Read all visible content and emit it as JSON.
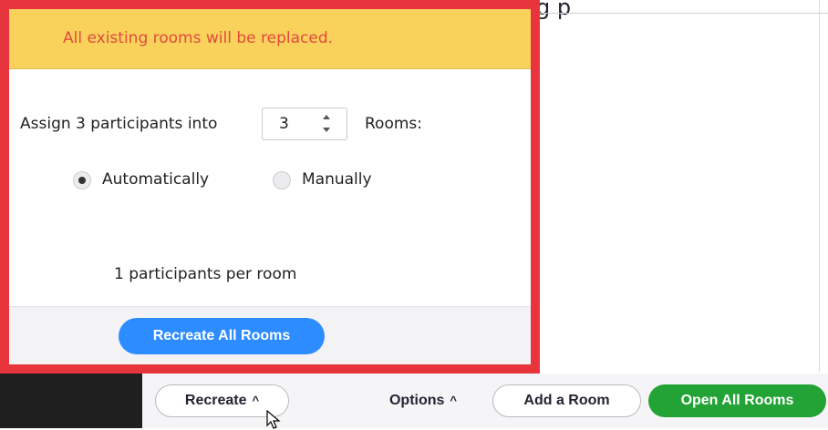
{
  "background": {
    "heading_fragment": "g          p"
  },
  "popover": {
    "warning": "All existing rooms will be replaced.",
    "assign_prefix": "Assign 3 participants into",
    "rooms_count": "3",
    "rooms_suffix": "Rooms:",
    "options": [
      {
        "label": "Automatically",
        "selected": true
      },
      {
        "label": "Manually",
        "selected": false
      }
    ],
    "per_room_text": "1 participants per room",
    "primary_button": "Recreate All Rooms"
  },
  "toolbar": {
    "recreate_label": "Recreate",
    "options_label": "Options",
    "add_room_label": "Add a Room",
    "open_all_label": "Open All Rooms",
    "caret_glyph": "^"
  },
  "colors": {
    "highlight": "#e8353d",
    "warning_bg": "#f9d25b",
    "warning_text": "#e24a3e",
    "primary_blue": "#2d8cff",
    "open_green": "#23a236"
  }
}
